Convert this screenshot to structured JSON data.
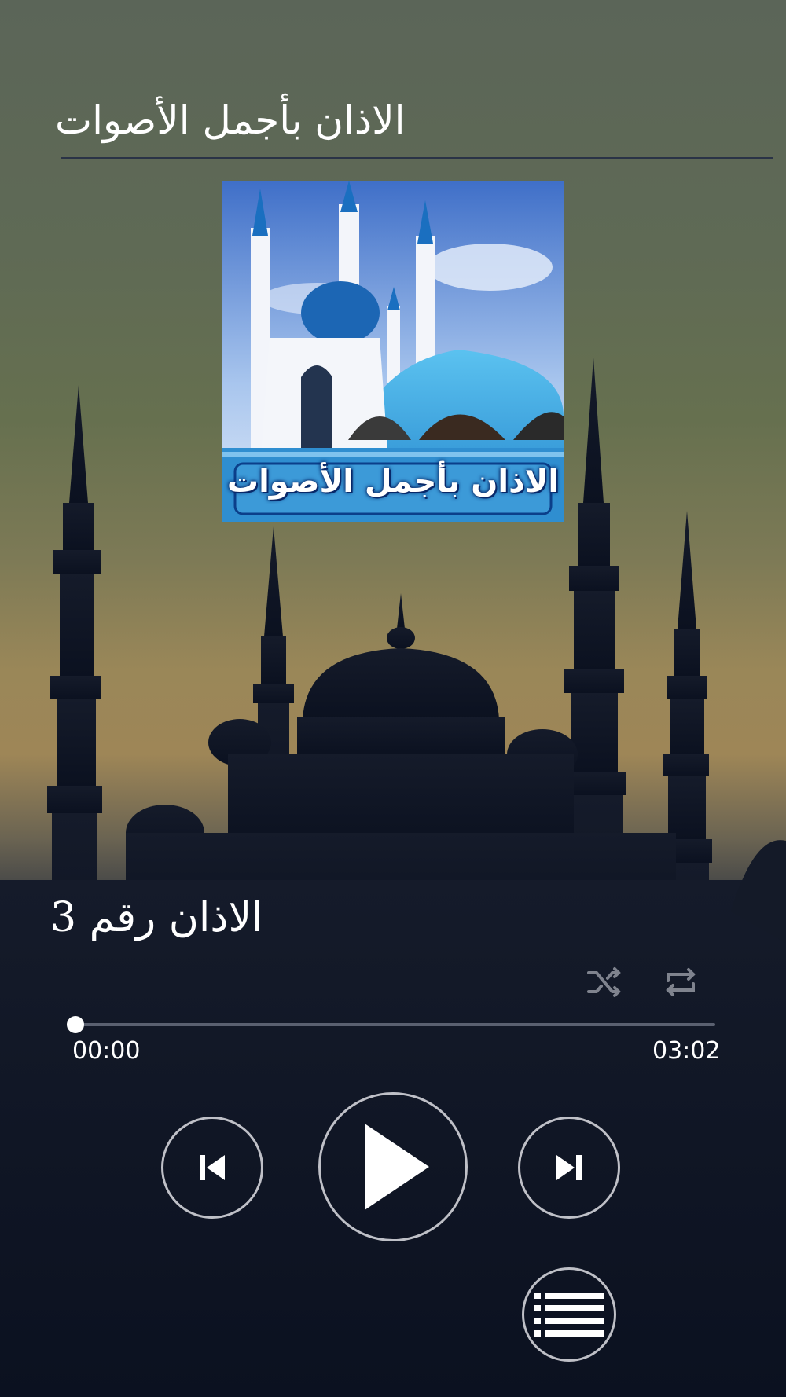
{
  "header": {
    "title": "الاذان بأجمل الأصوات"
  },
  "album": {
    "caption": "الاذان بأجمل الأصوات"
  },
  "player": {
    "track_title": "الاذان رقم 3",
    "current_time": "00:00",
    "total_time": "03:02",
    "progress": 0.0
  },
  "icons": {
    "shuffle": "shuffle-icon",
    "repeat": "repeat-icon",
    "previous": "skip-previous-icon",
    "play": "play-icon",
    "next": "skip-next-icon",
    "playlist": "playlist-icon"
  },
  "colors": {
    "divider": "#2a3346",
    "accent": "#ffffff",
    "dome_blue": "#3aa0df"
  }
}
